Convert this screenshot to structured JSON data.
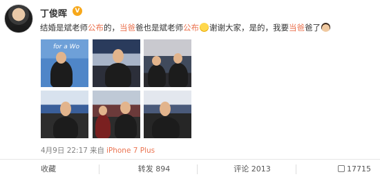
{
  "user": {
    "name": "丁俊晖",
    "verified_badge": "V"
  },
  "post": {
    "segments": [
      {
        "text": "结婚是斌老师",
        "tag": false
      },
      {
        "text": "公布",
        "tag": true
      },
      {
        "text": "的，",
        "tag": false
      },
      {
        "text": "当爸",
        "tag": true
      },
      {
        "text": "爸也是斌老师",
        "tag": false
      },
      {
        "text": "公布",
        "tag": true
      },
      {
        "text": "谢谢大家，是的，我要",
        "tag": false
      },
      {
        "text": "当爸",
        "tag": true
      },
      {
        "text": "爸了",
        "tag": false
      }
    ],
    "emojis": [
      "smile-emoji",
      "face-emoji"
    ]
  },
  "photos": {
    "p1_banner": "for a Wo"
  },
  "meta": {
    "date": "4月9日 22:17",
    "from": "来自",
    "device": "iPhone 7 Plus"
  },
  "actions": {
    "favorite": "收藏",
    "repost": "转发 894",
    "comment": "评论 2013",
    "like": "17715"
  },
  "colors": {
    "link": "#eb7350",
    "badge": "#f7a81b",
    "muted": "#808080"
  }
}
